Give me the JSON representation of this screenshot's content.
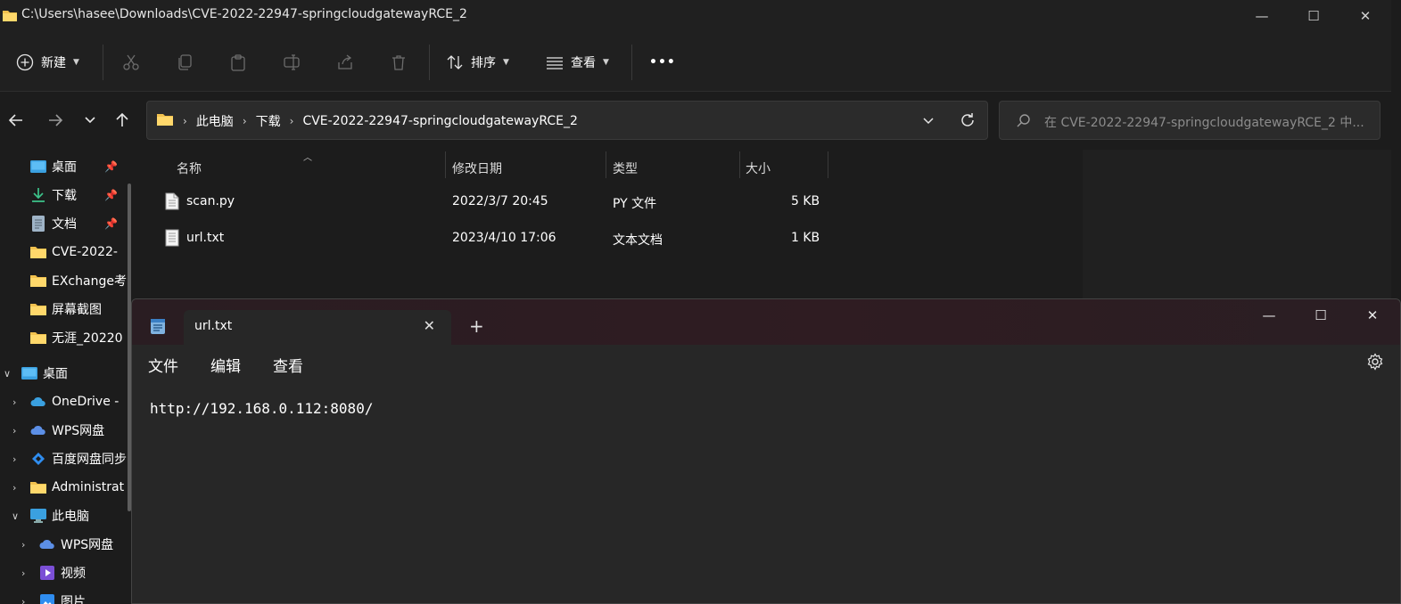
{
  "explorer": {
    "title": "C:\\Users\\hasee\\Downloads\\CVE-2022-22947-springcloudgatewayRCE_2",
    "window_controls": [
      "—",
      "☐",
      "✕"
    ],
    "commands": {
      "new_label": "新建",
      "sort_label": "排序",
      "view_label": "查看",
      "more_label": "•••"
    },
    "address": {
      "crumbs": [
        "此电脑",
        "下载",
        "CVE-2022-22947-springcloudgatewayRCE_2"
      ]
    },
    "search": {
      "placeholder": "在 CVE-2022-22947-springcloudgatewayRCE_2 中..."
    },
    "nav": {
      "quick_access": [
        {
          "label": "桌面",
          "icon": "desktop-icon"
        },
        {
          "label": "下载",
          "icon": "download-icon"
        },
        {
          "label": "文档",
          "icon": "document-icon"
        },
        {
          "label": "CVE-2022-",
          "icon": "folder-icon"
        },
        {
          "label": "EXchange考",
          "icon": "folder-icon"
        },
        {
          "label": "屏幕截图",
          "icon": "folder-icon"
        },
        {
          "label": "无涯_20220",
          "icon": "folder-icon"
        }
      ],
      "tree": [
        {
          "label": "桌面",
          "icon": "desktop-icon"
        },
        {
          "label": "OneDrive -",
          "icon": "cloud-icon"
        },
        {
          "label": "WPS网盘",
          "icon": "cloud-icon"
        },
        {
          "label": "百度网盘同步",
          "icon": "baidu-icon"
        },
        {
          "label": "Administrat",
          "icon": "folder-icon"
        },
        {
          "label": "此电脑",
          "icon": "computer-icon"
        },
        {
          "label": "WPS网盘",
          "icon": "cloud-icon"
        },
        {
          "label": "视频",
          "icon": "video-icon"
        },
        {
          "label": "图片",
          "icon": "picture-icon"
        }
      ]
    },
    "columns": {
      "name": "名称",
      "modified": "修改日期",
      "type": "类型",
      "size": "大小"
    },
    "files": [
      {
        "name": "scan.py",
        "modified": "2022/3/7 20:45",
        "type": "PY 文件",
        "size": "5 KB"
      },
      {
        "name": "url.txt",
        "modified": "2023/4/10 17:06",
        "type": "文本文档",
        "size": "1 KB"
      }
    ]
  },
  "notepad": {
    "tab_title": "url.txt",
    "tab_close": "✕",
    "new_tab": "+",
    "window_controls": [
      "—",
      "☐",
      "✕"
    ],
    "menu": {
      "file": "文件",
      "edit": "编辑",
      "view": "查看"
    },
    "content": "http://192.168.0.112:8080/"
  },
  "colors": {
    "background": "#1c1c1c",
    "folder": "#f2c14e",
    "accent": "#4cc2ff"
  }
}
